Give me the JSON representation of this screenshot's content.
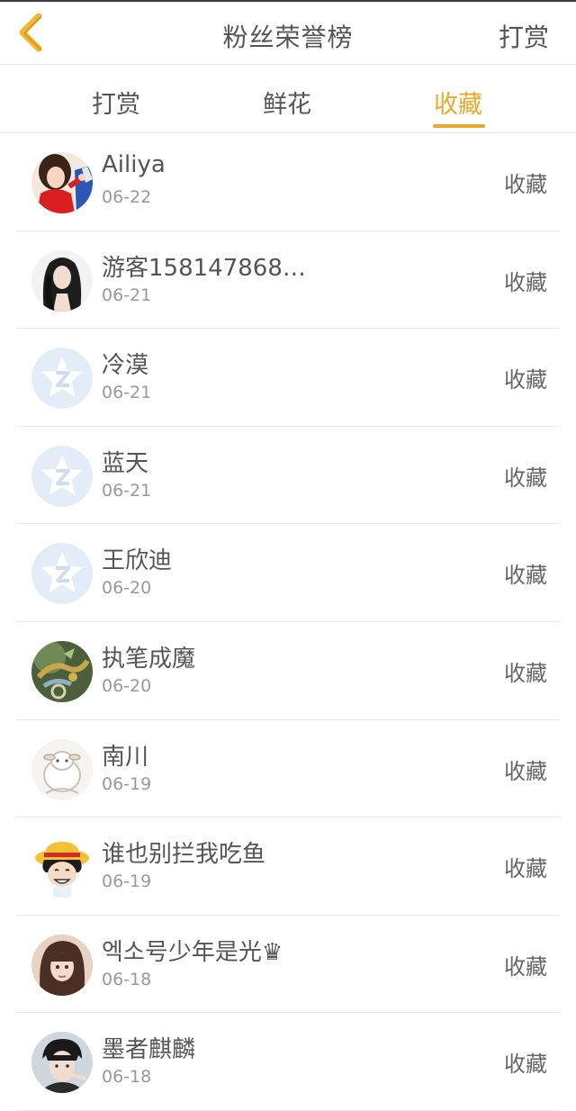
{
  "header": {
    "title": "粉丝荣誉榜",
    "right_action": "打赏"
  },
  "tabs": [
    {
      "label": "打赏",
      "active": false
    },
    {
      "label": "鲜花",
      "active": false
    },
    {
      "label": "收藏",
      "active": true
    }
  ],
  "accent_color": "#e9a92b",
  "rows": [
    {
      "name": "Ailiya",
      "date": "06-22",
      "action": "收藏",
      "avatar": "girl-red-avatar"
    },
    {
      "name": "游客1581478688...",
      "date": "06-21",
      "action": "收藏",
      "avatar": "girl-longhair-avatar"
    },
    {
      "name": "冷漠",
      "date": "06-21",
      "action": "收藏",
      "avatar": "default-star-avatar"
    },
    {
      "name": "蓝天",
      "date": "06-21",
      "action": "收藏",
      "avatar": "default-star-avatar"
    },
    {
      "name": "王欣迪",
      "date": "06-20",
      "action": "收藏",
      "avatar": "default-star-avatar"
    },
    {
      "name": "执笔成魔",
      "date": "06-20",
      "action": "收藏",
      "avatar": "dragon-avatar"
    },
    {
      "name": "南川",
      "date": "06-19",
      "action": "收藏",
      "avatar": "sheep-avatar"
    },
    {
      "name": "谁也别拦我吃鱼",
      "date": "06-19",
      "action": "收藏",
      "avatar": "luffy-avatar"
    },
    {
      "name": "엑소号少年是光♛",
      "date": "06-18",
      "action": "收藏",
      "avatar": "girl-bangs-avatar"
    },
    {
      "name": "墨者麒麟",
      "date": "06-18",
      "action": "收藏",
      "avatar": "boy-avatar"
    }
  ]
}
